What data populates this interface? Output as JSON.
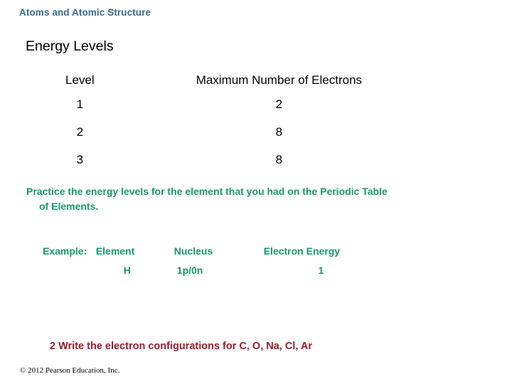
{
  "slide": {
    "banner_title": "Atoms and Atomic Structure",
    "section_heading": "Energy Levels",
    "colors": {
      "banner": "#35688f",
      "green": "#169a62",
      "red": "#9c1b2a",
      "text": "#000000",
      "background": "#ffffff"
    }
  },
  "energy_table": {
    "headers": {
      "level": "Level",
      "max_electrons": "Maximum Number of Electrons"
    },
    "rows": [
      {
        "level": "1",
        "max_electrons": "2"
      },
      {
        "level": "2",
        "max_electrons": "8"
      },
      {
        "level": "3",
        "max_electrons": "8"
      }
    ]
  },
  "practice": {
    "line_1": "Practice the energy levels for the element that you had on the Periodic Table",
    "line_2": "of Elements."
  },
  "example_table": {
    "headers": {
      "label": "Example:",
      "element": "Element",
      "nucleus": "Nucleus",
      "electron_energy": "Electron Energy"
    },
    "rows": [
      {
        "label": "",
        "element": "H",
        "nucleus": "1p/0n",
        "electron_energy": "1"
      }
    ]
  },
  "assignment": {
    "text": "2  Write the electron configurations for C, O, Na, Cl, Ar"
  },
  "footer": {
    "copyright": "© 2012 Pearson Education, Inc."
  }
}
